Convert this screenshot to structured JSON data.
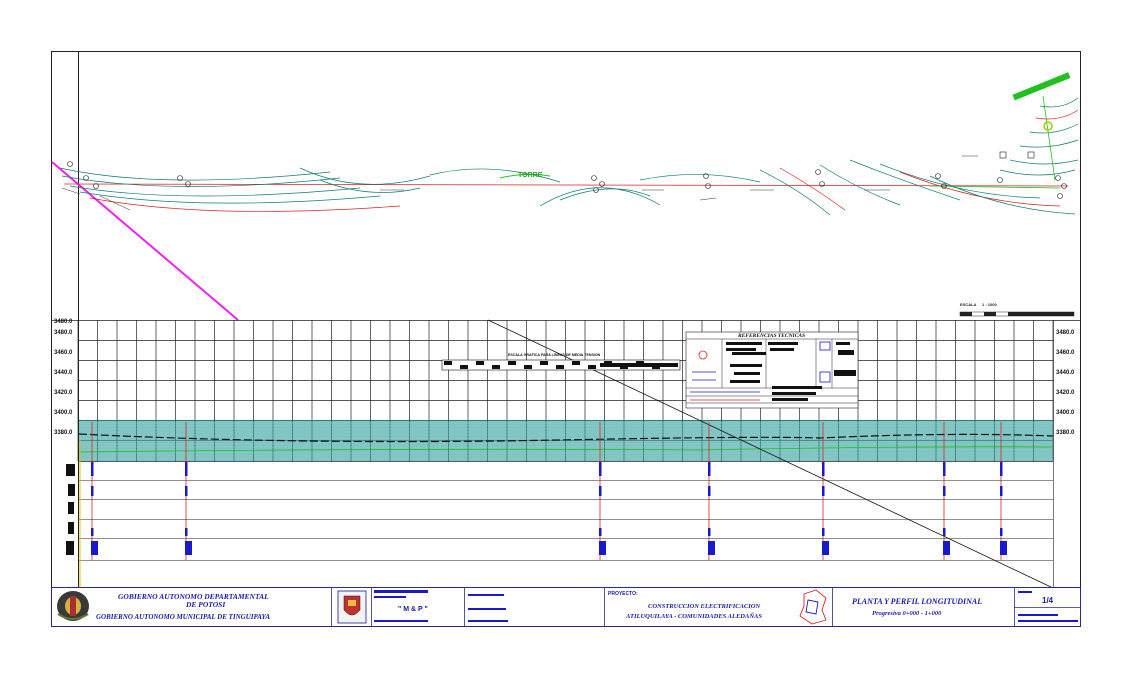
{
  "drawing": {
    "scale_label": "ESCALA",
    "scale_value": "1 : 1000",
    "plan_label": "TORRE",
    "elevations": [
      "3480.0",
      "3460.0",
      "3440.0",
      "3420.0",
      "3400.0",
      "3380.0"
    ],
    "top_elevation": "3480.0"
  },
  "legend": {
    "title": "REFERENCIAS TECNICAS",
    "bar_label": "ESCALA GRAFICA PARA LINEAS DE MEDIA TENSION"
  },
  "title_block": {
    "entity_line1": "GOBIERNO AUTONOMO DEPARTAMENTAL",
    "entity_line2": "DE POTOSI",
    "entity_line3": "GOBIERNO AUTONOMO MUNICIPAL DE TINGUIPAYA",
    "logo_text": "\" M & P \"",
    "project_label": "PROYECTO:",
    "project_line1": "CONSTRUCCION ELECTRIFICACION",
    "project_line2": "ATILUQUILAYA - COMUNIDADES ALEDAÑAS",
    "sheet_title": "PLANTA Y PERFIL LONGITUDINAL",
    "progressive": "Progresiva 0+000 - 1+000",
    "sheet_number": "1/4"
  },
  "colors": {
    "frame": "#2a2a8a",
    "alignment": "#dd2222",
    "magenta": "#ee22ee",
    "contour": "#127a7a",
    "terrain_fill": "#1c8f8f",
    "pole_blue": "#1a1acc"
  }
}
